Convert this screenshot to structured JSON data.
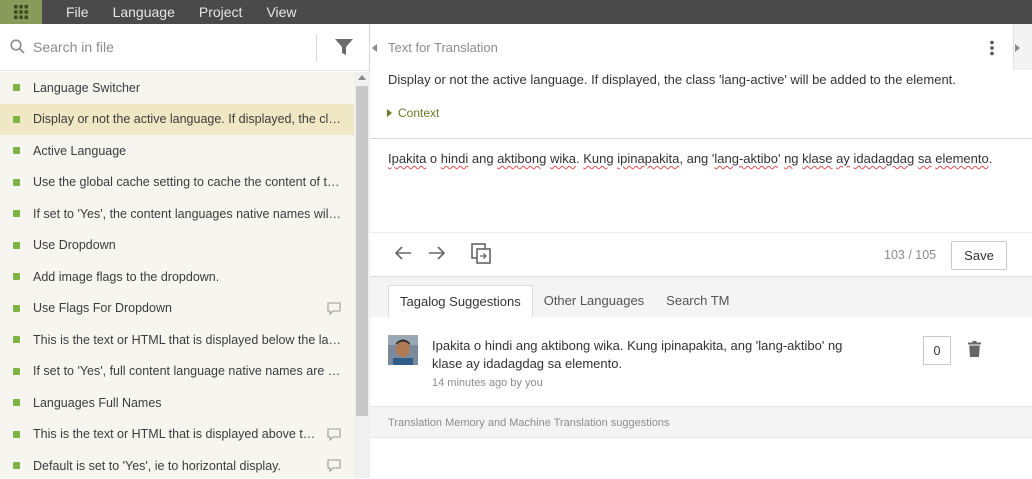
{
  "menubar": {
    "items": [
      "File",
      "Language",
      "Project",
      "View"
    ]
  },
  "search": {
    "placeholder": "Search in file"
  },
  "list": {
    "items": [
      {
        "text": "Language Switcher",
        "comment": false,
        "active": false
      },
      {
        "text": "Display or not the active language. If displayed, the clas...",
        "comment": false,
        "active": true
      },
      {
        "text": "Active Language",
        "comment": false,
        "active": false
      },
      {
        "text": "Use the global cache setting to cache the content of thi...",
        "comment": false,
        "active": false
      },
      {
        "text": "If set to 'Yes', the content languages native names will ...",
        "comment": false,
        "active": false
      },
      {
        "text": "Use Dropdown",
        "comment": false,
        "active": false
      },
      {
        "text": "Add image flags to the dropdown.",
        "comment": false,
        "active": false
      },
      {
        "text": "Use Flags For Dropdown",
        "comment": true,
        "active": false
      },
      {
        "text": "This is the text or HTML that is displayed below the lan...",
        "comment": false,
        "active": false
      },
      {
        "text": "If set to 'Yes', full content language native names are di...",
        "comment": false,
        "active": false
      },
      {
        "text": "Languages Full Names",
        "comment": false,
        "active": false
      },
      {
        "text": "This is the text or HTML that is displayed above the ...",
        "comment": true,
        "active": false
      },
      {
        "text": "Default is set to 'Yes', ie to horizontal display.",
        "comment": true,
        "active": false
      }
    ]
  },
  "source": {
    "title": "Text for Translation",
    "text": "Display or not the active language. If displayed, the class 'lang-active' will be added to the element.",
    "context_label": "Context"
  },
  "translation": {
    "words": [
      "Ipakita",
      " o ",
      "hindi",
      " ang ",
      "aktibong",
      " ",
      "wika",
      ". ",
      "Kung",
      " ",
      "ipinapakita",
      ", ang '",
      "lang-aktibo",
      "' ",
      "ng",
      " ",
      "klase",
      " ",
      "ay",
      " ",
      "idadagdag",
      " ",
      "sa",
      " ",
      "elemento",
      "."
    ],
    "counter": "103 / 105",
    "save_label": "Save"
  },
  "tabs": [
    "Tagalog Suggestions",
    "Other Languages",
    "Search TM"
  ],
  "suggestion": {
    "text": "Ipakita o hindi ang aktibong wika. Kung ipinapakita, ang 'lang-aktibo' ng klase ay idadagdag sa elemento.",
    "meta": "14 minutes ago by you",
    "count": "0"
  },
  "tm_note": "Translation Memory and Machine Translation suggestions",
  "colors": {
    "menubar": "#4a4a4a",
    "grid_button": "#8a9a5b",
    "status_dot": "#7cb342",
    "active_row": "#f0e8c4",
    "context": "#6b7a2a"
  }
}
